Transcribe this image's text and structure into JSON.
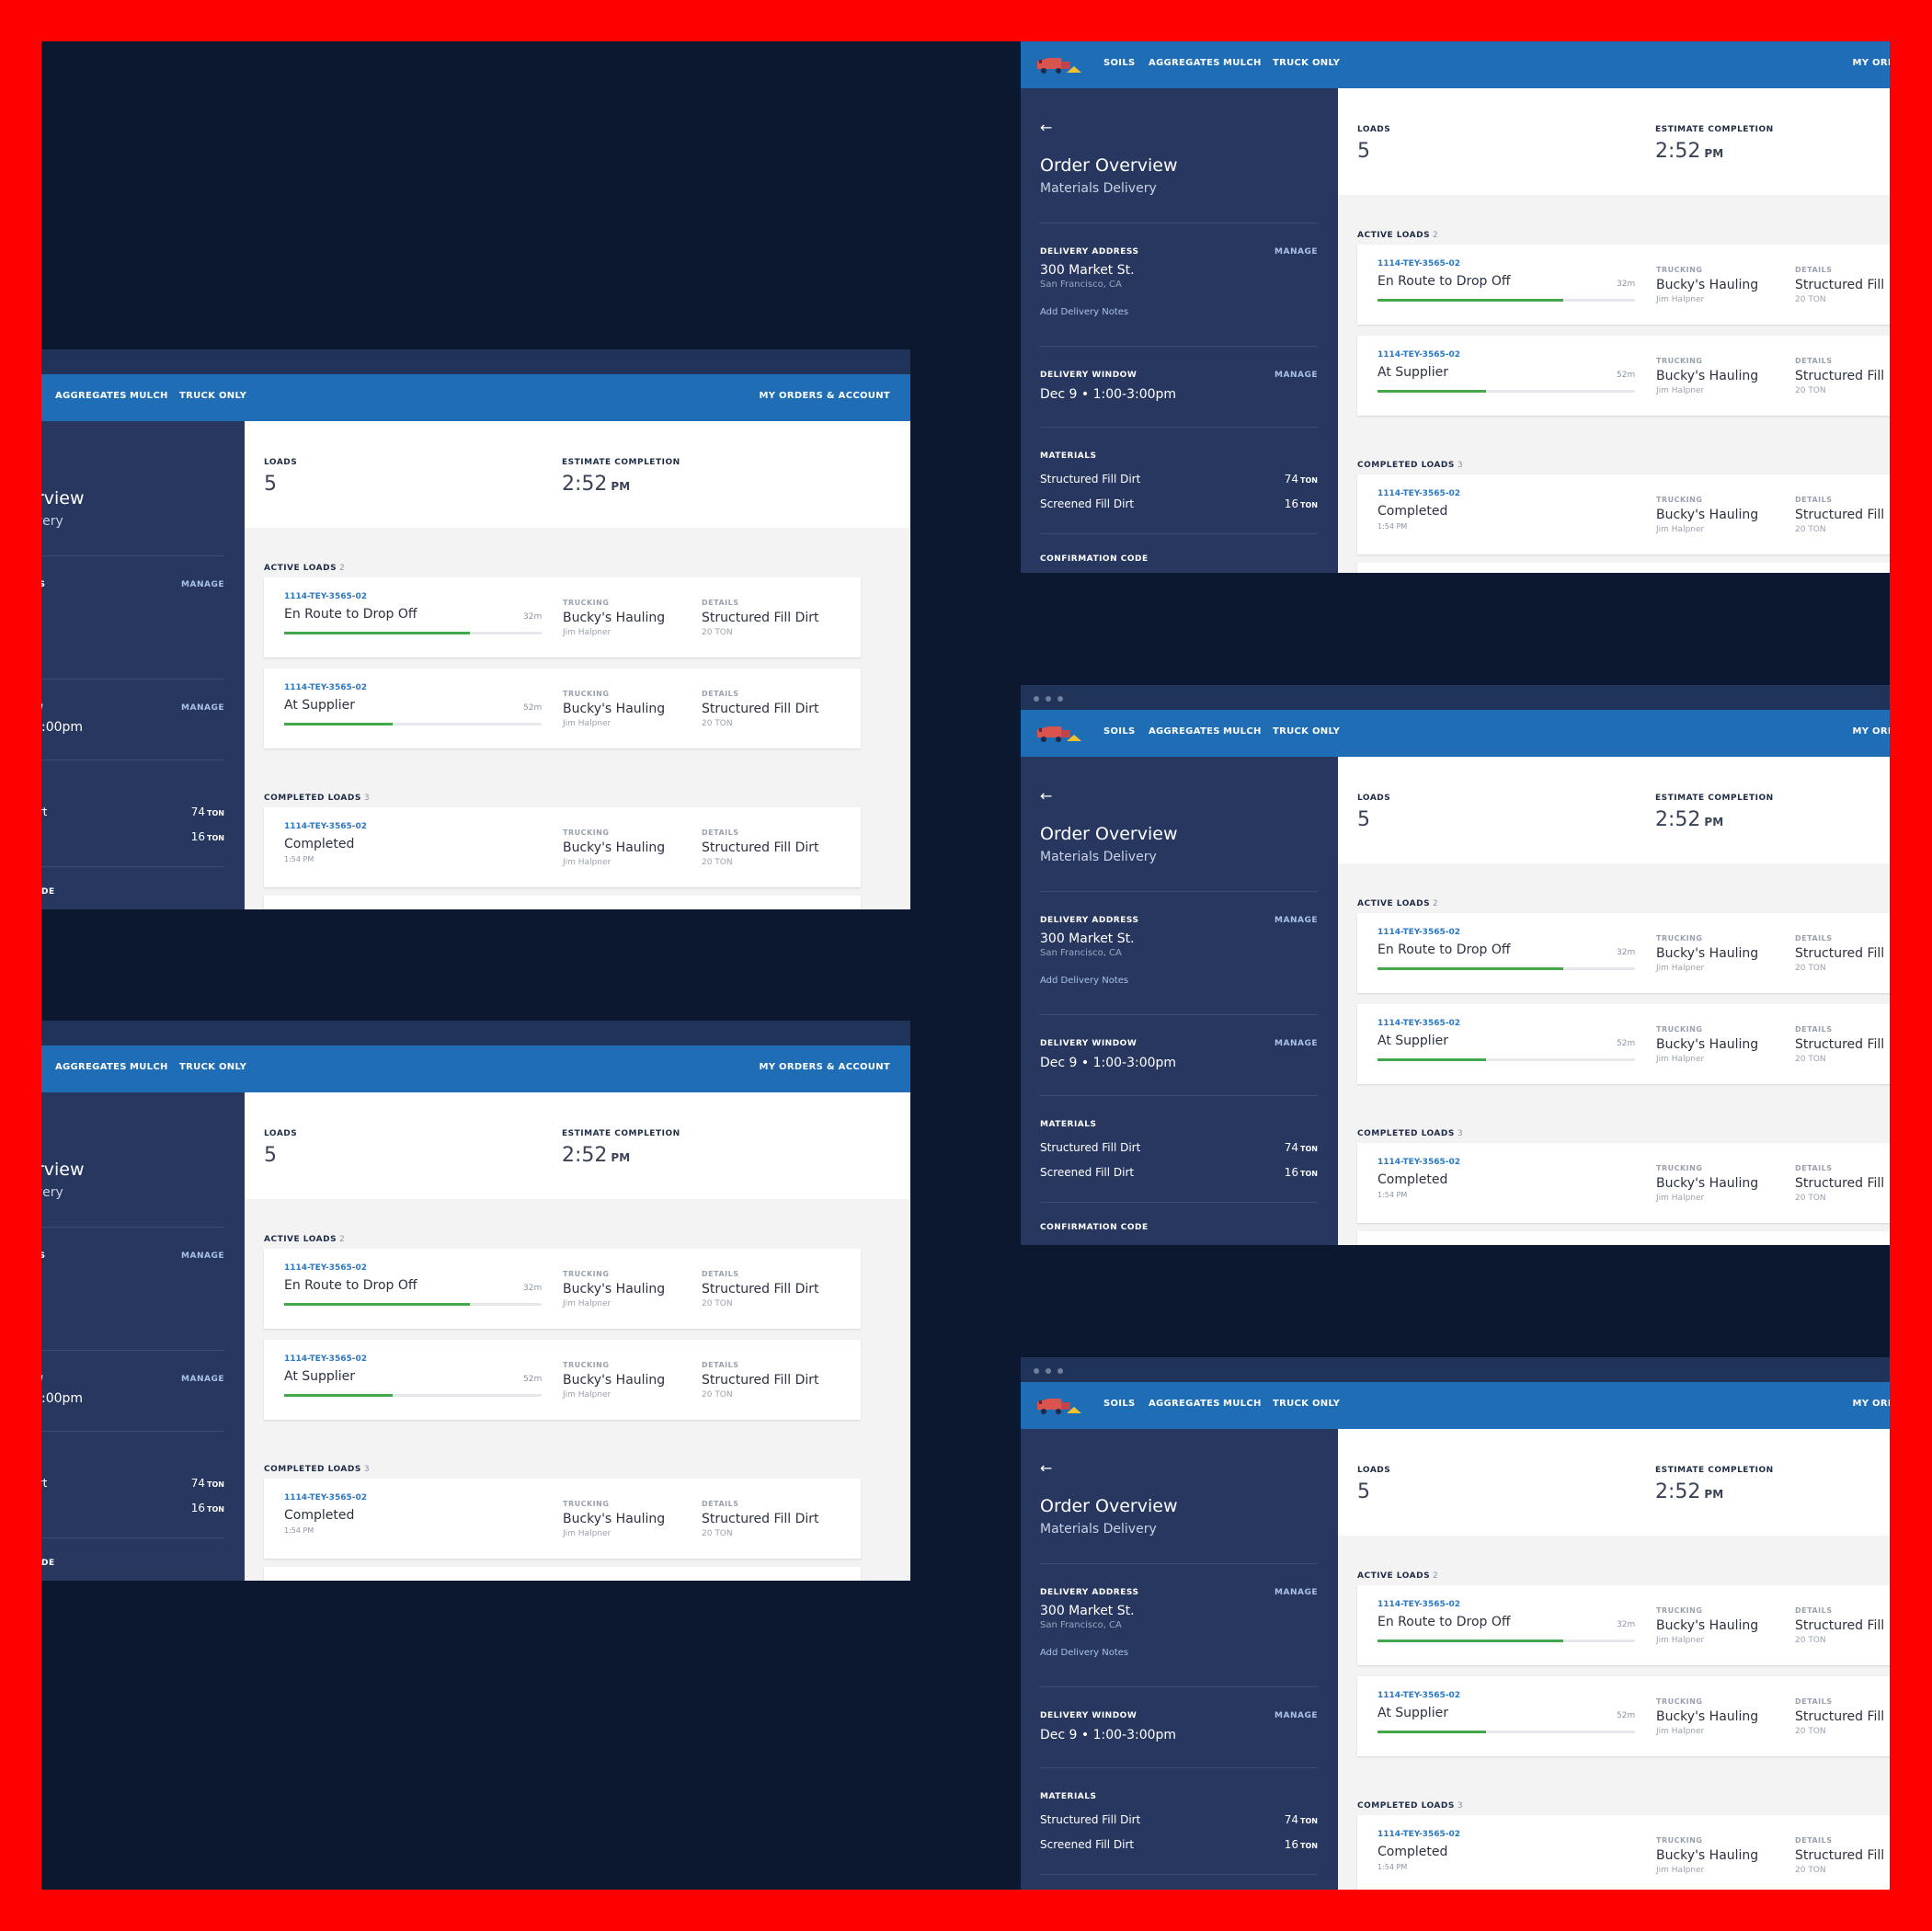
{
  "nav": {
    "items": [
      "SOILS",
      "AGGREGATES",
      "MULCH",
      "TRUCK ONLY"
    ],
    "account": "MY ORDERS & ACCOUNT"
  },
  "page": {
    "back_icon": "arrow-left-icon",
    "title": "Order Overview",
    "subtitle": "Materials Delivery"
  },
  "delivery_address": {
    "label": "DELIVERY ADDRESS",
    "manage": "MANAGE",
    "street": "300 Market St.",
    "city": "San Francisco, CA",
    "notes_link": "Add Delivery Notes"
  },
  "delivery_window": {
    "label": "DELIVERY WINDOW",
    "manage": "MANAGE",
    "value": "Dec 9  •  1:00-3:00pm"
  },
  "materials": {
    "label": "MATERIALS",
    "items": [
      {
        "name": "Structured Fill Dirt",
        "qty": "74",
        "unit": "TON"
      },
      {
        "name": "Screened Fill Dirt",
        "qty": "16",
        "unit": "TON"
      }
    ]
  },
  "confirmation": {
    "label": "CONFIRMATION CODE"
  },
  "summary": {
    "loads_label": "LOADS",
    "loads_value": "5",
    "completion_label": "ESTIMATE COMPLETION",
    "completion_time": "2:52",
    "completion_suffix": "PM"
  },
  "active_loads": {
    "label": "ACTIVE LOADS",
    "count": "2",
    "items": [
      {
        "id": "1114-TEY-3565-02",
        "status": "En Route to Drop Off",
        "eta": "32m",
        "progress": 0.72,
        "trucking_label": "TRUCKING",
        "trucking": "Bucky's Hauling",
        "driver": "Jim Halpner",
        "details_label": "DETAILS",
        "material": "Structured Fill Dirt",
        "amount": "20 TON"
      },
      {
        "id": "1114-TEY-3565-02",
        "status": "At Supplier",
        "eta": "52m",
        "progress": 0.42,
        "trucking_label": "TRUCKING",
        "trucking": "Bucky's Hauling",
        "driver": "Jim Halpner",
        "details_label": "DETAILS",
        "material": "Structured Fill Dirt",
        "amount": "20 TON"
      }
    ]
  },
  "completed_loads": {
    "label": "COMPLETED LOADS",
    "count": "3",
    "items": [
      {
        "id": "1114-TEY-3565-02",
        "status": "Completed",
        "time": "1:54 PM",
        "trucking_label": "TRUCKING",
        "trucking": "Bucky's Hauling",
        "driver": "Jim Halpner",
        "details_label": "DETAILS",
        "material": "Structured Fill Dirt",
        "amount": "20 TON"
      }
    ]
  },
  "colors": {
    "background": "#0c1730",
    "frame": "#ff0000",
    "nav": "#1e6db5",
    "sidebar": "#27375f",
    "progress": "#43a84b",
    "link": "#2b78c2"
  }
}
